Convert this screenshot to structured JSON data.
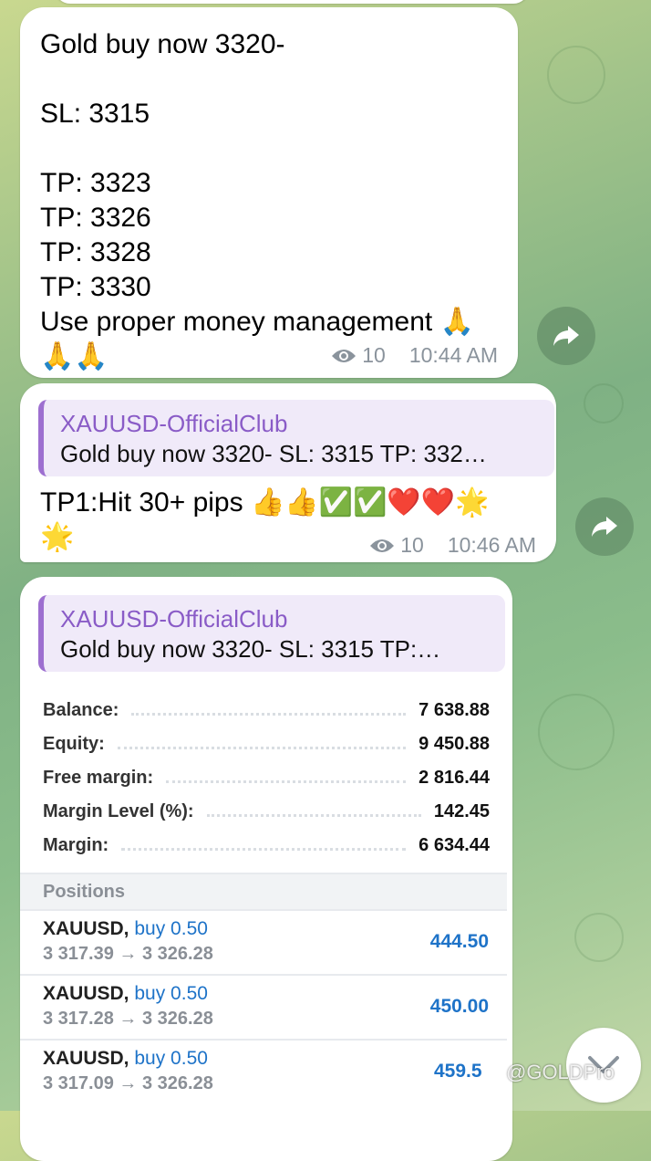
{
  "messages": [
    {
      "text": "Gold buy now 3320-\n\nSL: 3315\n\nTP: 3323\nTP: 3326\nTP: 3328\nTP: 3330\nUse proper money management 🙏\n🙏🙏",
      "views": "10",
      "time": "10:44 AM"
    },
    {
      "reply_name": "XAUUSD-OfficialClub",
      "reply_text": "Gold buy now 3320-   SL: 3315  TP: 332…",
      "text": "TP1:Hit 30+ pips 👍👍✅✅❤️❤️🌟\n🌟",
      "views": "10",
      "time": "10:46 AM"
    },
    {
      "reply_name": "XAUUSD-OfficialClub",
      "reply_text": "Gold buy now 3320-   SL: 3315  TP:…"
    }
  ],
  "account": {
    "rows": [
      {
        "label": "Balance:",
        "value": "7 638.88"
      },
      {
        "label": "Equity:",
        "value": "9 450.88"
      },
      {
        "label": "Free margin:",
        "value": "2 816.44"
      },
      {
        "label": "Margin Level (%):",
        "value": "142.45"
      },
      {
        "label": "Margin:",
        "value": "6 634.44"
      }
    ],
    "positions_header": "Positions",
    "positions": [
      {
        "symbol": "XAUUSD,",
        "direction": "buy 0.50",
        "prices": "3 317.39 → 3 326.28",
        "profit": "444.50"
      },
      {
        "symbol": "XAUUSD,",
        "direction": "buy 0.50",
        "prices": "3 317.28 → 3 326.28",
        "profit": "450.00"
      },
      {
        "symbol": "XAUUSD,",
        "direction": "buy 0.50",
        "prices": "3 317.09 → 3 326.28",
        "profit": "459.5"
      }
    ]
  },
  "watermark": "@GOLDPro",
  "colors": {
    "reply_accent": "#9d6fd0",
    "reply_name": "#8a5cc7",
    "profit_blue": "#1e73c8",
    "meta_gray": "#8a939c"
  }
}
